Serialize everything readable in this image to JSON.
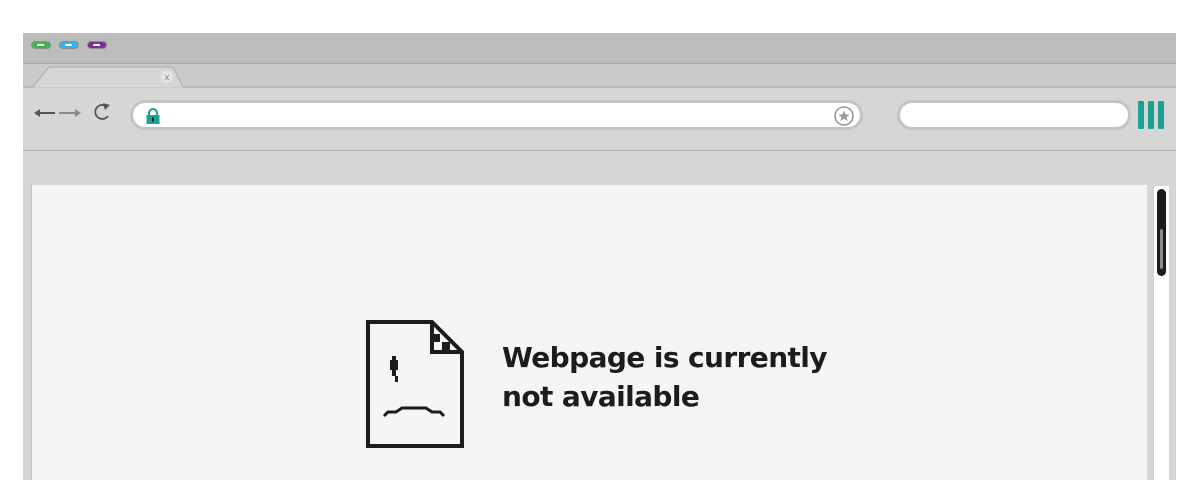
{
  "window_controls": [
    {
      "name": "green",
      "color": "#3fb54a"
    },
    {
      "name": "blue",
      "color": "#35b3ea"
    },
    {
      "name": "purple",
      "color": "#7a2f95"
    }
  ],
  "tab": {
    "close_glyph": "x"
  },
  "toolbar": {
    "back_icon": "back-arrow-icon",
    "forward_icon": "forward-arrow-icon",
    "reload_icon": "reload-icon",
    "address_value": "",
    "search_value": "",
    "accent_color": "#1aa394"
  },
  "error": {
    "line1": "Webpage is currently",
    "line2": "not available",
    "icon": "sad-page-icon"
  }
}
